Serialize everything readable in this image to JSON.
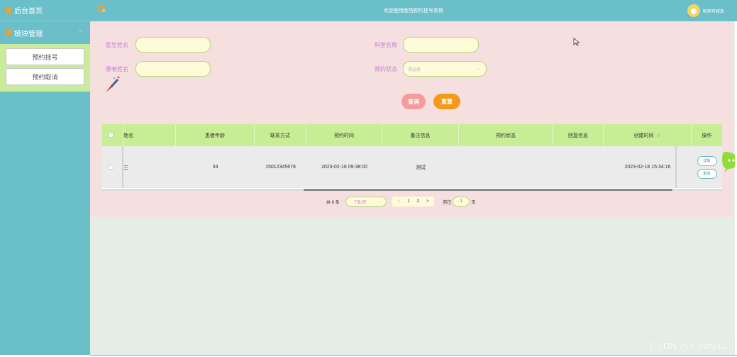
{
  "sidebar": {
    "home_label": "后台首页",
    "module_label": "模块管理",
    "module_chevron": "^",
    "items": [
      {
        "label": "预约挂号"
      },
      {
        "label": "预约取消"
      }
    ]
  },
  "topbar": {
    "title": "欢迎使用医院预约挂号系统",
    "user_label": "昵称可修改"
  },
  "search": {
    "doctor_label": "医生姓名",
    "dept_label": "科室名称",
    "patient_label": "患者姓名",
    "status_label": "预约状态",
    "status_placeholder": "请选择",
    "query_button": "查询",
    "reset_button": "重置"
  },
  "table": {
    "columns": [
      "姓名",
      "患者年龄",
      "联系方式",
      "预约时间",
      "备注信息",
      "预约状态",
      "回复信息",
      "创建时间",
      "操作"
    ],
    "sort_icon": "⇕",
    "rows": [
      {
        "name": "三",
        "age": "33",
        "phone": "15012345678",
        "appt_time": "2023-02-18 09:38:00",
        "note": "测试",
        "status": "",
        "reply": "",
        "created": "2023-02-18 15:34:16",
        "actions": [
          "详情",
          "取消"
        ]
      }
    ]
  },
  "pager": {
    "total": "共 9 条",
    "page_size": "7条/页",
    "prev": "<",
    "pages": [
      "1",
      "2"
    ],
    "next": ">",
    "goto_label": "前往",
    "goto_value": "1",
    "page_suffix": "页"
  },
  "watermark": "CSDN @v_cxsj813",
  "colors": {
    "sidebar": "#6bbfc9",
    "submenu": "#c9ec9a",
    "panel": "#f6dfdf",
    "table_header": "#c7ee94",
    "query_button": "#f49b9b",
    "reset_button": "#f39a1b"
  }
}
